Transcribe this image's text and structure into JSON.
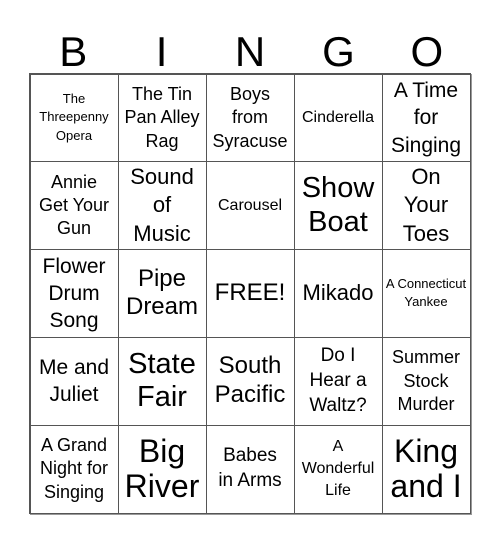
{
  "header": [
    "B",
    "I",
    "N",
    "G",
    "O"
  ],
  "cells": [
    [
      "The Threepenny Opera",
      "The Tin Pan Alley Rag",
      "Boys from Syracuse",
      "Cinderella",
      "A Time for Singing"
    ],
    [
      "Annie Get Your Gun",
      "Sound of Music",
      "Carousel",
      "Show Boat",
      "On Your Toes"
    ],
    [
      "Flower Drum Song",
      "Pipe Dream",
      "FREE!",
      "Mikado",
      "A Connecticut Yankee"
    ],
    [
      "Me and Juliet",
      "State Fair",
      "South Pacific",
      "Do I Hear a Waltz?",
      "Summer Stock Murder"
    ],
    [
      "A Grand Night for Singing",
      "Big River",
      "Babes in Arms",
      "A Wonderful Life",
      "King and I"
    ]
  ]
}
